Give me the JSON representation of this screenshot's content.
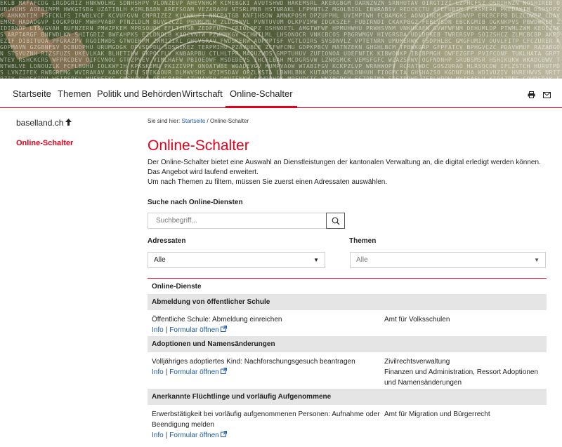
{
  "nav": {
    "items": [
      "Startseite",
      "Themen",
      "Politik und Behörden",
      "Wirtschaft",
      "Online-Schalter"
    ],
    "active": "Online-Schalter"
  },
  "sidebar": {
    "home_label": "baselland.ch",
    "active_label": "Online-Schalter"
  },
  "breadcrumb": {
    "prefix": "Sie sind hier:",
    "home": "Startseite",
    "separator": "/",
    "current": "Online-Schalter"
  },
  "page": {
    "title": "Online-Schalter",
    "intro": [
      "Der Online-Schalter bietet eine Auswahl an Dienstleistungen der kantonalen Verwaltung an, die digital erledigt werden können.",
      "Das Angebot wird laufend erweitert.",
      "Um nach Themen zu filtern, müssen Sie zuerst einen Adressaten auswählen."
    ]
  },
  "search": {
    "label": "Suche nach Online-Diensten",
    "placeholder": "Suchbegriff..."
  },
  "filters": {
    "adressaten_label": "Adressaten",
    "adressaten_value": "Alle",
    "themen_label": "Themen",
    "themen_value": "Alle"
  },
  "table": {
    "header": "Online-Dienste",
    "info_label": "Info",
    "link_sep": "|",
    "form_label": "Formular öffnen",
    "groups": [
      {
        "title": "Abmeldung von öffentlicher Schule",
        "rows": [
          {
            "desc": "Öffentliche Schule: Abmeldung einreichen",
            "office": [
              "Amt für Volksschulen"
            ]
          }
        ]
      },
      {
        "title": "Adoptionen und Namensänderungen",
        "rows": [
          {
            "desc": "Volljähriges adoptiertes Kind: Nachforschungsgesuch beantragen",
            "office": [
              "Zivilrechtsverwaltung",
              "Finanzen und Administration, Ressort Adoptionen und Namensänderungen"
            ]
          }
        ]
      },
      {
        "title": "Anerkannte Flüchtlinge und vorläufig Aufgenommene",
        "rows": [
          {
            "desc": "Erwerbstätigkeit bei vorläufig aufgenommenen Personen: Aufnahme oder Beendigung melden",
            "office": [
              "Amt für Migration und Bürgerrecht"
            ]
          }
        ]
      }
    ]
  },
  "colors": {
    "accent": "#e2001a",
    "link": "#1a5aa0",
    "group_bg": "#e5e5e5"
  },
  "icons": {
    "print": "print-icon",
    "mail": "mail-icon",
    "search": "search-icon",
    "up": "arrow-up-icon",
    "external": "external-link-icon",
    "caret": "caret-down-icon"
  }
}
